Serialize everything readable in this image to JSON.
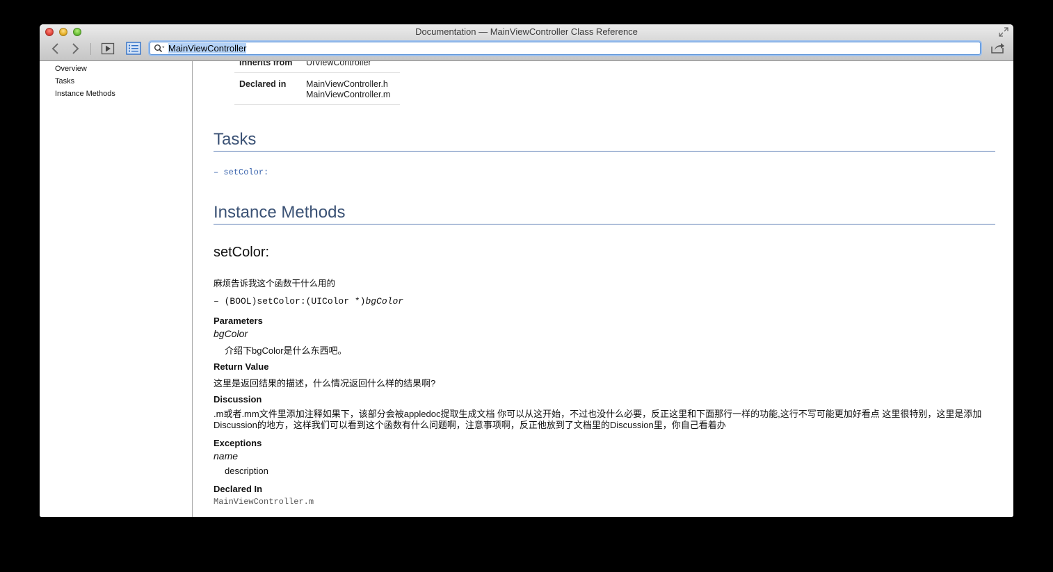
{
  "window": {
    "title": "Documentation — MainViewController Class Reference"
  },
  "toolbar": {
    "search_value": "MainViewController"
  },
  "sidebar": {
    "items": [
      {
        "label": "Overview"
      },
      {
        "label": "Tasks"
      },
      {
        "label": "Instance Methods"
      }
    ]
  },
  "spec_table": {
    "rows": [
      {
        "key": "Inherits from",
        "values": [
          "UIViewController"
        ]
      },
      {
        "key": "Declared in",
        "values": [
          "MainViewController.h",
          "MainViewController.m"
        ]
      }
    ]
  },
  "tasks": {
    "heading": "Tasks",
    "items": [
      {
        "dash": "–",
        "name": "setColor:"
      }
    ]
  },
  "instance_methods": {
    "heading": "Instance Methods",
    "method": {
      "name": "setColor:",
      "abstract": "麻烦告诉我这个函数干什么用的",
      "declaration_prefix": "– (BOOL)setColor:(UIColor *)",
      "declaration_param": "bgColor",
      "parameters_label": "Parameters",
      "param_name": "bgColor",
      "param_desc": "介绍下bgColor是什么东西吧。",
      "return_label": "Return Value",
      "return_value": "这里是返回结果的描述，什么情况返回什么样的结果啊?",
      "discussion_label": "Discussion",
      "discussion": ".m或者.mm文件里添加注释如果下，该部分会被appledoc提取生成文档 你可以从这开始，不过也没什么必要，反正这里和下面那行一样的功能,这行不写可能更加好看点 这里很特别，这里是添加Discussion的地方，这样我们可以看到这个函数有什么问题啊，注意事项啊，反正他放到了文档里的Discussion里，你自己看着办",
      "exceptions_label": "Exceptions",
      "exception_name": "name",
      "exception_desc": "description",
      "declared_in_label": "Declared In",
      "declared_in_file": "MainViewController.m"
    }
  }
}
